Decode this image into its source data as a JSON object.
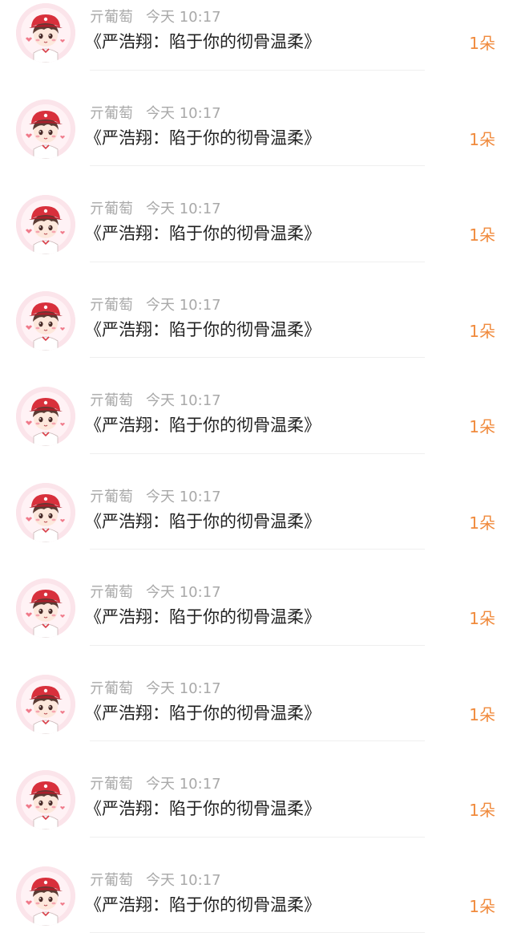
{
  "colors": {
    "meta_text": "#a9a9a9",
    "message_text": "#222222",
    "count_text": "#f08a3c",
    "avatar_bg": "#fbe4ea"
  },
  "items": [
    {
      "user": "亓葡萄",
      "time": "今天 10:17",
      "message": "《严浩翔：陷于你的彻骨温柔》",
      "count": "1朵",
      "avatar_icon": "chibi-boy-red-cap-icon"
    },
    {
      "user": "亓葡萄",
      "time": "今天 10:17",
      "message": "《严浩翔：陷于你的彻骨温柔》",
      "count": "1朵",
      "avatar_icon": "chibi-boy-red-cap-icon"
    },
    {
      "user": "亓葡萄",
      "time": "今天 10:17",
      "message": "《严浩翔：陷于你的彻骨温柔》",
      "count": "1朵",
      "avatar_icon": "chibi-boy-red-cap-icon"
    },
    {
      "user": "亓葡萄",
      "time": "今天 10:17",
      "message": "《严浩翔：陷于你的彻骨温柔》",
      "count": "1朵",
      "avatar_icon": "chibi-boy-red-cap-icon"
    },
    {
      "user": "亓葡萄",
      "time": "今天 10:17",
      "message": "《严浩翔：陷于你的彻骨温柔》",
      "count": "1朵",
      "avatar_icon": "chibi-boy-red-cap-icon"
    },
    {
      "user": "亓葡萄",
      "time": "今天 10:17",
      "message": "《严浩翔：陷于你的彻骨温柔》",
      "count": "1朵",
      "avatar_icon": "chibi-boy-red-cap-icon"
    },
    {
      "user": "亓葡萄",
      "time": "今天 10:17",
      "message": "《严浩翔：陷于你的彻骨温柔》",
      "count": "1朵",
      "avatar_icon": "chibi-boy-red-cap-icon"
    },
    {
      "user": "亓葡萄",
      "time": "今天 10:17",
      "message": "《严浩翔：陷于你的彻骨温柔》",
      "count": "1朵",
      "avatar_icon": "chibi-boy-red-cap-icon"
    },
    {
      "user": "亓葡萄",
      "time": "今天 10:17",
      "message": "《严浩翔：陷于你的彻骨温柔》",
      "count": "1朵",
      "avatar_icon": "chibi-boy-red-cap-icon"
    },
    {
      "user": "亓葡萄",
      "time": "今天 10:17",
      "message": "《严浩翔：陷于你的彻骨温柔》",
      "count": "1朵",
      "avatar_icon": "chibi-boy-red-cap-icon"
    }
  ]
}
